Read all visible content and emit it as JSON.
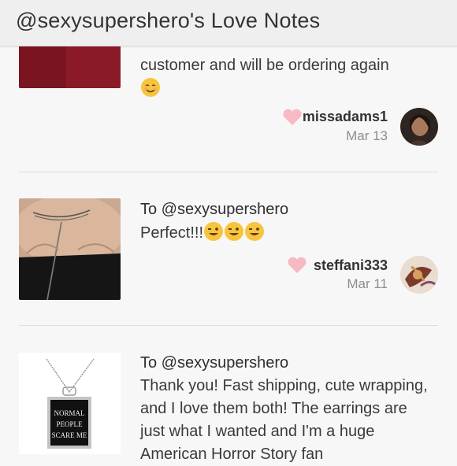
{
  "header": {
    "title": "@sexysupershero's Love Notes"
  },
  "notes": [
    {
      "message_tail": "customer and will be ordering again",
      "message_emoji": "smiling-face",
      "username": "missadams1",
      "date": "Mar 13",
      "heart_color": "#f6b7c2"
    },
    {
      "to": "To @sexysupershero",
      "message": "Perfect!!!",
      "message_emoji": "winking-face",
      "username": "steffani333",
      "date": "Mar 11",
      "heart_color": "#f6b7c2"
    },
    {
      "to": "To @sexysupershero",
      "message": "Thank you! Fast shipping, cute wrapping, and I love them both! The earrings are just what I wanted and I'm a huge American Horror Story fan",
      "product_lettering": "NORMAL PEOPLE SCARE ME"
    }
  ]
}
